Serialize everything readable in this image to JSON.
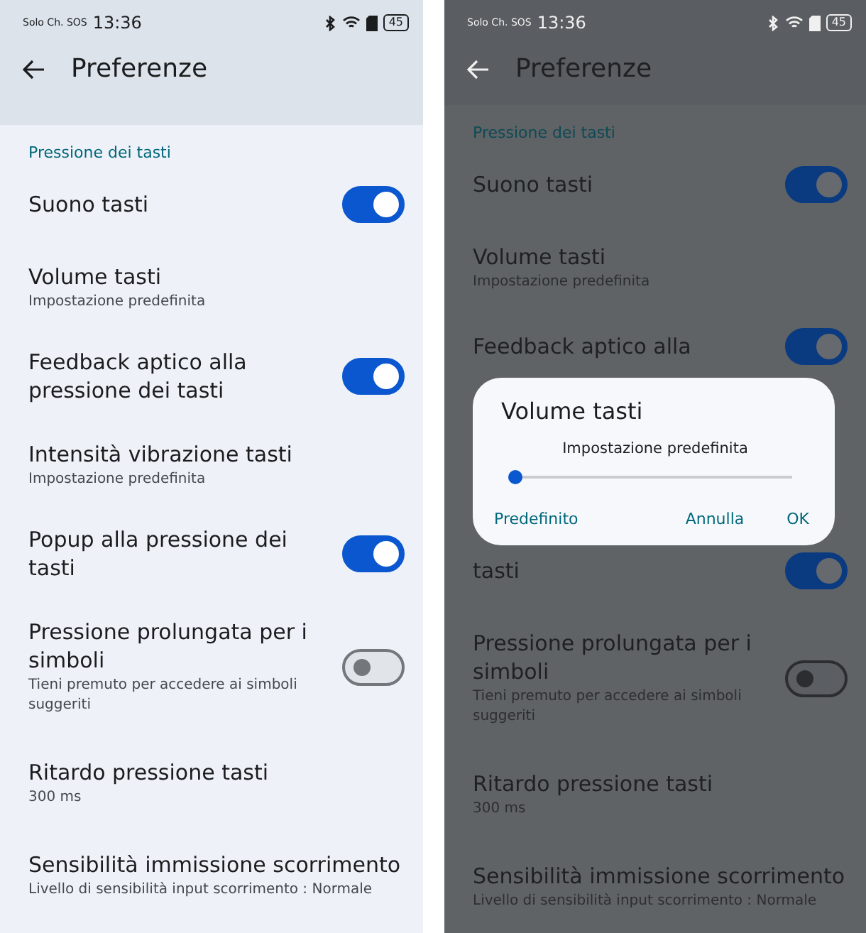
{
  "screens": [
    {
      "dimmed": false,
      "status_bar": {
        "carrier": "Solo Ch. SOS",
        "time": "13:36",
        "battery": "45"
      },
      "title": "Preferenze",
      "section": "Pressione dei tasti",
      "items": [
        {
          "title": "Suono tasti",
          "kind": "switch",
          "on": true
        },
        {
          "title": "Volume tasti",
          "subtitle": "Impostazione predefinita",
          "kind": "plain"
        },
        {
          "title": "Feedback aptico alla pressione dei tasti",
          "kind": "switch",
          "on": true
        },
        {
          "title": "Intensità vibrazione tasti",
          "subtitle": "Impostazione predefinita",
          "kind": "plain"
        },
        {
          "title": "Popup alla pressione dei tasti",
          "kind": "switch",
          "on": true
        },
        {
          "title": "Pressione prolungata per i simboli",
          "subtitle": "Tieni premuto per accedere ai simboli suggeriti",
          "kind": "switch",
          "on": false
        },
        {
          "title": "Ritardo pressione tasti",
          "subtitle": "300 ms",
          "kind": "plain"
        },
        {
          "title": "Sensibilità immissione scorrimento",
          "subtitle": "Livello di sensibilità input scorrimento : Normale",
          "kind": "plain"
        }
      ]
    },
    {
      "dimmed": true,
      "status_bar": {
        "carrier": "Solo Ch. SOS",
        "time": "13:36",
        "battery": "45"
      },
      "title": "Preferenze",
      "section": "Pressione dei tasti",
      "items": [
        {
          "title": "Suono tasti",
          "kind": "switch",
          "on": true
        },
        {
          "title": "Volume tasti",
          "subtitle": "Impostazione predefinita",
          "kind": "plain"
        },
        {
          "title": "Feedback aptico alla",
          "kind": "switch",
          "on": true
        }
      ],
      "dialog": {
        "title": "Volume tasti",
        "label": "Impostazione predefinita",
        "level": 0,
        "buttons": [
          "Predefinito",
          "Annulla",
          "OK"
        ]
      },
      "items_below": [
        {
          "title": "tasti",
          "kind": "switch",
          "on": true
        },
        {
          "title": "Pressione prolungata per i simboli",
          "subtitle": "Tieni premuto per accedere ai simboli suggeriti",
          "kind": "switch",
          "on": false
        },
        {
          "title": "Ritardo pressione tasti",
          "subtitle": "300 ms",
          "kind": "plain"
        },
        {
          "title": "Sensibilità immissione scorrimento",
          "subtitle": "Livello di sensibilità input scorrimento : Normale",
          "kind": "plain"
        }
      ]
    }
  ]
}
